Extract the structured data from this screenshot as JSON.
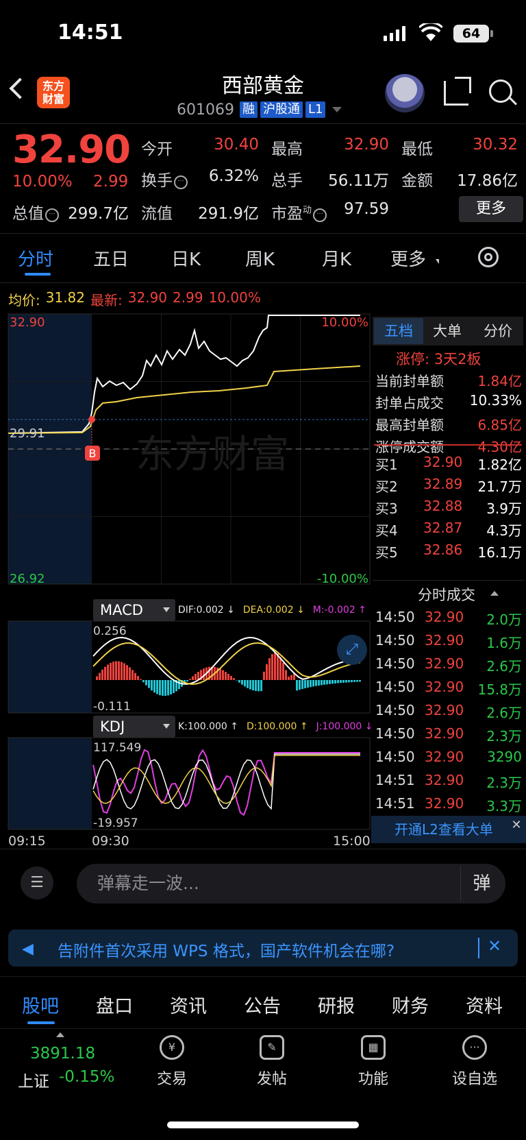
{
  "status_bar": {
    "time": "14:51",
    "battery": "64"
  },
  "header": {
    "app_logo": "东方\n财富",
    "stock_name": "西部黄金",
    "stock_code": "601069",
    "tags": [
      "融",
      "沪股通",
      "L1"
    ]
  },
  "quote": {
    "price": "32.90",
    "change_pct": "10.00%",
    "change_amt": "2.99",
    "fields": {
      "open_label": "今开",
      "open": "30.40",
      "high_label": "最高",
      "high": "32.90",
      "low_label": "最低",
      "low": "30.32",
      "turnover_label": "换手",
      "turnover": "6.32%",
      "volume_label": "总手",
      "volume": "56.11万",
      "amount_label": "金额",
      "amount": "17.86亿",
      "mktcap_label": "总值",
      "mktcap": "299.7亿",
      "float_label": "流值",
      "float": "291.9亿",
      "pe_label": "市盈",
      "pe_sup": "动",
      "pe": "97.59"
    },
    "more_button": "更多"
  },
  "tabs": [
    "分时",
    "五日",
    "日K",
    "周K",
    "月K",
    "更多"
  ],
  "avg_line": {
    "avg_label": "均价:",
    "avg_value": "31.82",
    "latest_label": "最新:",
    "latest_value": "32.90",
    "latest_chg": "2.99",
    "latest_pct": "10.00%"
  },
  "chart_labels": {
    "y_top": "32.90",
    "y_mid": "29.91",
    "y_bottom": "26.92",
    "pct_top": "10.00%",
    "pct_bottom": "-10.00%",
    "watermark": "东方财富",
    "buy_marker": "B",
    "time_start": "09:15",
    "time_open": "09:30",
    "time_close": "15:00"
  },
  "macd": {
    "name": "MACD",
    "dif": "DIF:0.002 ↓",
    "dea": "DEA:0.002 ↓",
    "m": "M:-0.002 ↑",
    "y_top": "0.256",
    "y_bottom": "-0.111"
  },
  "kdj": {
    "name": "KDJ",
    "k": "K:100.000 ↑",
    "d": "D:100.000 ↑",
    "j": "J:100.000 ↓",
    "y_top": "117.549",
    "y_bottom": "-19.957"
  },
  "right_panel": {
    "tabs": [
      "五档",
      "大单",
      "分价"
    ],
    "limit_up": "涨停: 3天2板",
    "stats": [
      {
        "label": "当前封单额",
        "value": "1.84亿",
        "color": "#f0433e"
      },
      {
        "label": "封单占成交",
        "value": "10.33%",
        "color": "#ffffff"
      },
      {
        "label": "最高封单额",
        "value": "6.85亿",
        "color": "#f0433e"
      },
      {
        "label": "涨停成交额",
        "value": "4.30亿",
        "color": "#f0433e"
      }
    ],
    "bids": [
      {
        "label": "买1",
        "price": "32.90",
        "vol": "1.82亿"
      },
      {
        "label": "买2",
        "price": "32.89",
        "vol": "21.7万"
      },
      {
        "label": "买3",
        "price": "32.88",
        "vol": "3.9万"
      },
      {
        "label": "买4",
        "price": "32.87",
        "vol": "4.3万"
      },
      {
        "label": "买5",
        "price": "32.86",
        "vol": "16.1万"
      }
    ],
    "ticks_header": "分时成交",
    "ticks": [
      {
        "time": "14:50",
        "price": "32.90",
        "vol": "2.0万"
      },
      {
        "time": "14:50",
        "price": "32.90",
        "vol": "1.6万"
      },
      {
        "time": "14:50",
        "price": "32.90",
        "vol": "2.6万"
      },
      {
        "time": "14:50",
        "price": "32.90",
        "vol": "15.8万"
      },
      {
        "time": "14:50",
        "price": "32.90",
        "vol": "2.6万"
      },
      {
        "time": "14:50",
        "price": "32.90",
        "vol": "2.3万"
      },
      {
        "time": "14:50",
        "price": "32.90",
        "vol": "3290"
      },
      {
        "time": "14:51",
        "price": "32.90",
        "vol": "2.3万"
      },
      {
        "time": "14:51",
        "price": "32.90",
        "vol": "3.3万"
      }
    ],
    "l2_banner": "开通L2查看大单"
  },
  "danmaku": {
    "placeholder": "弹幕走一波...",
    "send_label": "弹"
  },
  "notice": {
    "text": "告附件首次采用 WPS 格式，国产软件机会在哪?"
  },
  "bottom_tabs": [
    "股吧",
    "盘口",
    "资讯",
    "公告",
    "研报",
    "财务",
    "资料"
  ],
  "bottom_nav": {
    "index_value": "3891.18",
    "index_name": "上证",
    "index_change": "-0.15%",
    "items": [
      {
        "label": "交易",
        "icon": "¥"
      },
      {
        "label": "发帖",
        "icon": "✎"
      },
      {
        "label": "功能",
        "icon": "▦"
      },
      {
        "label": "设自选",
        "icon": "···"
      }
    ]
  },
  "colors": {
    "up": "#f0433e",
    "down": "#2bc84a",
    "accent": "#2f8cff",
    "avg_line": "#f1d24a"
  }
}
